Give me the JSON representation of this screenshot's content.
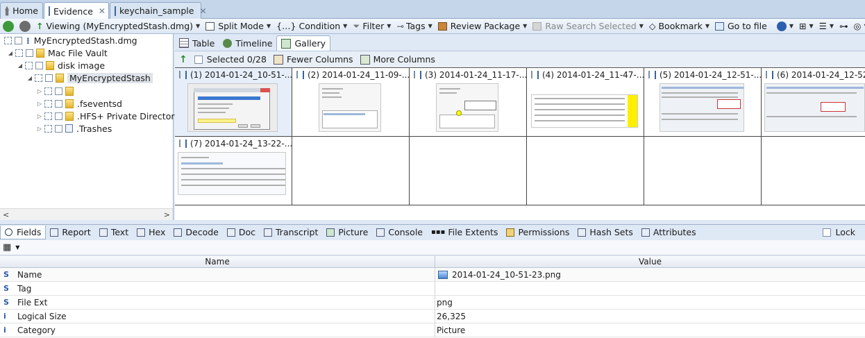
{
  "tabs": [
    {
      "label": "Home",
      "icon": "home-icon"
    },
    {
      "label": "Evidence",
      "icon": "evidence-icon",
      "active": true
    },
    {
      "label": "keychain_sample",
      "icon": "keychain-icon"
    }
  ],
  "toolbar": {
    "viewing_label": "Viewing (MyEncryptedStash.dmg)",
    "split_mode": "Split Mode",
    "condition": "Condition",
    "filter": "Filter",
    "tags": "Tags",
    "review_package": "Review Package",
    "raw_search": "Raw Search Selected",
    "bookmark": "Bookmark",
    "go_to_file": "Go to file"
  },
  "tree": {
    "root": "MyEncryptedStash.dmg",
    "mac_file_vault": "Mac File Vault",
    "disk_image": "disk image",
    "stash": "MyEncryptedStash",
    "children": [
      "",
      ".fseventsd",
      ".HFS+ Private Directory Da",
      ".Trashes"
    ]
  },
  "view_tabs": {
    "table": "Table",
    "timeline": "Timeline",
    "gallery": "Gallery"
  },
  "gallery_bar": {
    "selected": "Selected 0/28",
    "fewer": "Fewer Columns",
    "more": "More Columns"
  },
  "gallery": [
    "(1) 2014-01-24_10-51-...",
    "(2) 2014-01-24_11-09-...",
    "(3) 2014-01-24_11-17-...",
    "(4) 2014-01-24_11-47-...",
    "(5) 2014-01-24_12-51-...",
    "(6) 2014-01-24_12-52",
    "(7) 2014-01-24_13-22-..."
  ],
  "bottom_tabs": {
    "fields": "Fields",
    "report": "Report",
    "text": "Text",
    "hex": "Hex",
    "decode": "Decode",
    "doc": "Doc",
    "transcript": "Transcript",
    "picture": "Picture",
    "console": "Console",
    "file_extents": "File Extents",
    "permissions": "Permissions",
    "hash_sets": "Hash Sets",
    "attributes": "Attributes",
    "lock": "Lock"
  },
  "properties": {
    "col_name": "Name",
    "col_value": "Value",
    "rows": [
      {
        "type": "S",
        "name": "Name",
        "value": "2014-01-24_10-51-23.png"
      },
      {
        "type": "S",
        "name": "Tag",
        "value": ""
      },
      {
        "type": "S",
        "name": "File Ext",
        "value": "png"
      },
      {
        "type": "i",
        "name": "Logical Size",
        "value": "26,325"
      },
      {
        "type": "i",
        "name": "Category",
        "value": "Picture"
      }
    ]
  }
}
